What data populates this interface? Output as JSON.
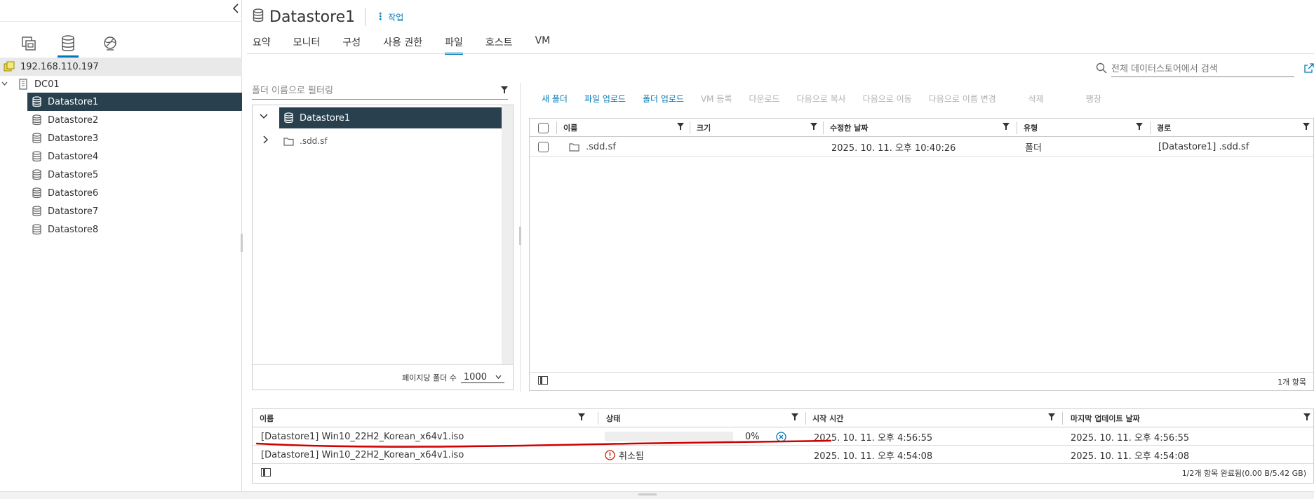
{
  "nav": {
    "icons": [
      "hosts-clusters-icon",
      "storage-icon",
      "network-icon"
    ],
    "host_ip": "192.168.110.197",
    "datacenter": "DC01",
    "datastores": [
      "Datastore1",
      "Datastore2",
      "Datastore3",
      "Datastore4",
      "Datastore5",
      "Datastore6",
      "Datastore7",
      "Datastore8"
    ],
    "selected": "Datastore1"
  },
  "header": {
    "title": "Datastore1",
    "actions_label": "작업"
  },
  "tabs": [
    "요약",
    "모니터",
    "구성",
    "사용 권한",
    "파일",
    "호스트",
    "VM"
  ],
  "active_tab": "파일",
  "search": {
    "placeholder": "전체 데이터스토어에서 검색"
  },
  "folder_tree": {
    "filter_placeholder": "폴더 이름으로 필터링",
    "root": "Datastore1",
    "children": [
      ".sdd.sf"
    ],
    "per_page_label": "페이지당 폴더 수",
    "per_page_value": "1000"
  },
  "toolbar": {
    "new_folder": "새 폴더",
    "upload_files": "파일 업로드",
    "upload_folder": "폴더 업로드",
    "register_vm": "VM 등록",
    "download": "다운로드",
    "copy_to": "다음으로 복사",
    "move_to": "다음으로 이동",
    "rename_to": "다음으로 이름 변경",
    "delete": "삭제",
    "inflate": "팽창"
  },
  "files_grid": {
    "columns": [
      "이름",
      "크기",
      "수정한 날짜",
      "유형",
      "경로"
    ],
    "rows": [
      {
        "name": ".sdd.sf",
        "size": "",
        "modified": "2025. 10. 11. 오후 10:40:26",
        "type": "폴더",
        "path": "[Datastore1] .sdd.sf"
      }
    ],
    "footer": "1개 항목"
  },
  "tasks": {
    "columns": [
      "이름",
      "상태",
      "시작 시간",
      "마지막 업데이트 날짜"
    ],
    "rows": [
      {
        "name": "[Datastore1] Win10_22H2_Korean_x64v1.iso",
        "progress": 0,
        "progress_text": "0%",
        "start": "2025. 10. 11. 오후 4:56:55",
        "updated": "2025. 10. 11. 오후 4:56:55"
      },
      {
        "name": "[Datastore1] Win10_22H2_Korean_x64v1.iso",
        "status": "취소됨",
        "start": "2025. 10. 11. 오후 4:54:08",
        "updated": "2025. 10. 11. 오후 4:54:08"
      }
    ],
    "footer": "1/2개 항목 완료됨(0.00 B/5.42 GB)"
  },
  "colors": {
    "accent": "#0079b8",
    "selected_bg": "#29414e",
    "error": "#c21d00",
    "annotation": "#d00000"
  }
}
